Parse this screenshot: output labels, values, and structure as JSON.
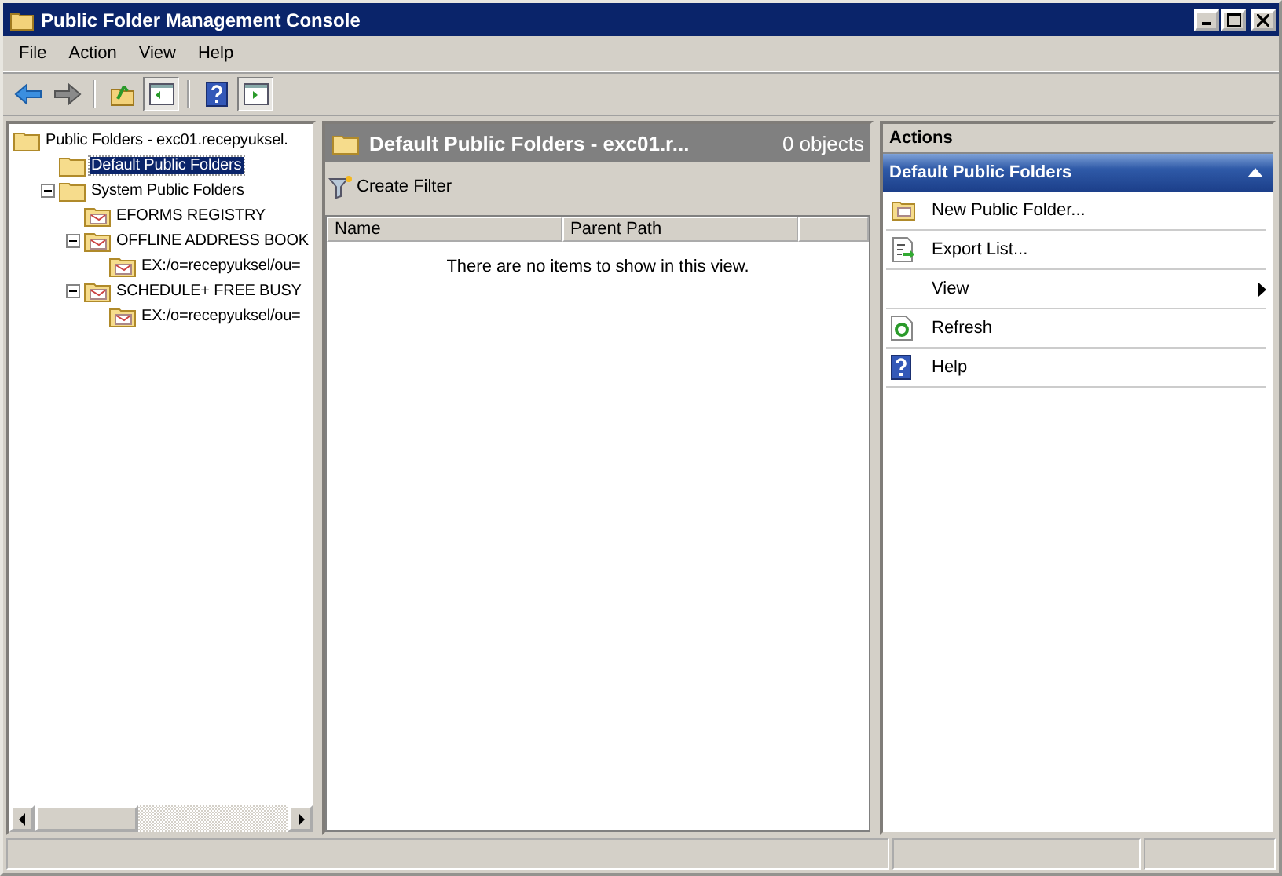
{
  "window": {
    "title": "Public Folder Management Console"
  },
  "menu": [
    "File",
    "Action",
    "View",
    "Help"
  ],
  "toolbar": [
    {
      "kind": "back",
      "pressed": false
    },
    {
      "kind": "forward",
      "pressed": false
    },
    {
      "kind": "sep"
    },
    {
      "kind": "up",
      "pressed": false
    },
    {
      "kind": "tree",
      "pressed": true
    },
    {
      "kind": "sep"
    },
    {
      "kind": "help",
      "pressed": false
    },
    {
      "kind": "pane",
      "pressed": true
    }
  ],
  "tree": [
    {
      "label": "Public Folders - exc01.recepyuksel.",
      "kind": "plain",
      "selected": false,
      "children": [
        {
          "label": "Default Public Folders",
          "kind": "plain",
          "selected": true
        },
        {
          "label": "System Public Folders",
          "kind": "plain",
          "selected": false,
          "expanded": true,
          "children": [
            {
              "label": "EFORMS REGISTRY",
              "kind": "mail",
              "selected": false
            },
            {
              "label": "OFFLINE ADDRESS BOOK",
              "kind": "mail",
              "selected": false,
              "expanded": true,
              "children": [
                {
                  "label": "EX:/o=recepyuksel/ou=",
                  "kind": "mail",
                  "selected": false
                }
              ]
            },
            {
              "label": "SCHEDULE+ FREE BUSY",
              "kind": "mail",
              "selected": false,
              "expanded": true,
              "children": [
                {
                  "label": "EX:/o=recepyuksel/ou=",
                  "kind": "mail",
                  "selected": false
                }
              ]
            }
          ]
        }
      ]
    }
  ],
  "content": {
    "title": "Default Public Folders - exc01.r...",
    "count": "0 objects",
    "filter": "Create Filter",
    "columns": [
      "Name",
      "Parent Path"
    ],
    "empty": "There are no items to show in this view."
  },
  "actions": {
    "title": "Actions",
    "section": "Default Public Folders",
    "expanded": true,
    "items": [
      {
        "label": "New Public Folder...",
        "kind": "folder",
        "submenu": false
      },
      {
        "label": "Export List...",
        "kind": "export",
        "submenu": false
      },
      {
        "label": "View",
        "kind": "plain",
        "submenu": true
      },
      {
        "label": "Refresh",
        "kind": "refresh",
        "submenu": false
      },
      {
        "label": "Help",
        "kind": "help",
        "submenu": false
      }
    ]
  }
}
